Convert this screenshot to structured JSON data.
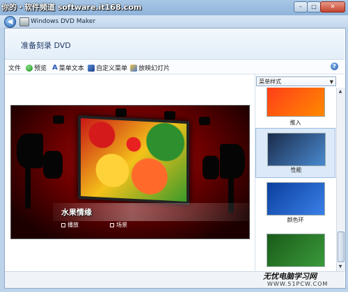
{
  "watermark_top": "你的・软件频道 software.it168.com",
  "window": {
    "title": "Windows DVD Maker",
    "minimize": "–",
    "maximize": "□",
    "close": "✕"
  },
  "nav": {
    "back_glyph": "◀"
  },
  "page_title": "准备刻录 DVD",
  "toolbar": {
    "items": [
      {
        "label": "文件",
        "icon": "none"
      },
      {
        "label": "预览",
        "icon": "play-icon"
      },
      {
        "label": "菜单文本",
        "icon": "text-a-icon"
      },
      {
        "label": "自定义菜单",
        "icon": "customize-menu-icon"
      },
      {
        "label": "放映幻灯片",
        "icon": "slideshow-icon"
      }
    ],
    "help": "?"
  },
  "preview": {
    "menu_title": "水果情缘",
    "options": [
      "播放",
      "场景"
    ]
  },
  "styles": {
    "selected_value": "菜单样式",
    "arrow": "▼",
    "items": [
      {
        "label": "推入",
        "colors": [
          "#ff3b1a",
          "#ff8a00"
        ],
        "selected": false
      },
      {
        "label": "性能",
        "colors": [
          "#1a2b4a",
          "#4a8ad0"
        ],
        "selected": true
      },
      {
        "label": "颜色环",
        "colors": [
          "#0b3f9e",
          "#3a80e8"
        ],
        "selected": false
      },
      {
        "label": "",
        "colors": [
          "#1a5a1a",
          "#3a9a3a"
        ],
        "selected": false
      }
    ]
  },
  "scrollbar": {
    "up": "▲",
    "down": "▼"
  },
  "watermark_bottom": {
    "text": "无忧电脑学习网",
    "url": "WWW.51PCW.COM"
  }
}
